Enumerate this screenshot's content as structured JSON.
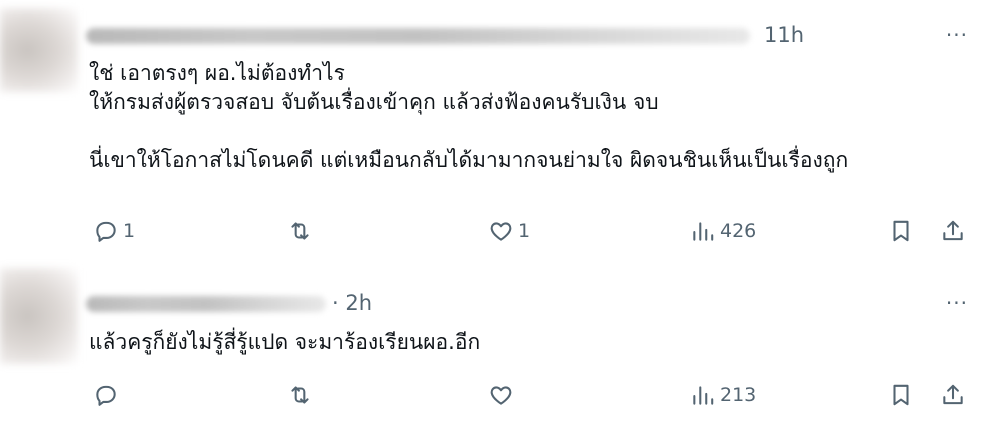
{
  "tweets": [
    {
      "time": "11h",
      "more": "···",
      "lines": [
        "ใช่ เอาตรงๆ ผอ.ไม่ต้องทำไร",
        "ให้กรมส่งผู้ตรวจสอบ จับต้นเรื่องเข้าคุก แล้วส่งฟ้องคนรับเงิน จบ",
        "",
        "นี่เขาให้โอกาสไม่โดนคดี แต่เหมือนกลับได้มามากจนย่ามใจ ผิดจนชินเห็นเป็นเรื่องถูก"
      ],
      "replies": "1",
      "likes": "1",
      "views": "426"
    },
    {
      "time": "· 2h",
      "more": "···",
      "lines": [
        "แล้วครูก็ยังไม่รู้สี่รู้แปด จะมาร้องเรียนผอ.อีก"
      ],
      "views": "213"
    }
  ],
  "icons": {
    "reply": "reply-icon",
    "retweet": "retweet-icon",
    "like": "heart-icon",
    "views": "views-icon",
    "bookmark": "bookmark-icon",
    "share": "share-icon"
  },
  "colors": {
    "text": "#0f1419",
    "muted": "#536471",
    "background": "#ffffff"
  }
}
